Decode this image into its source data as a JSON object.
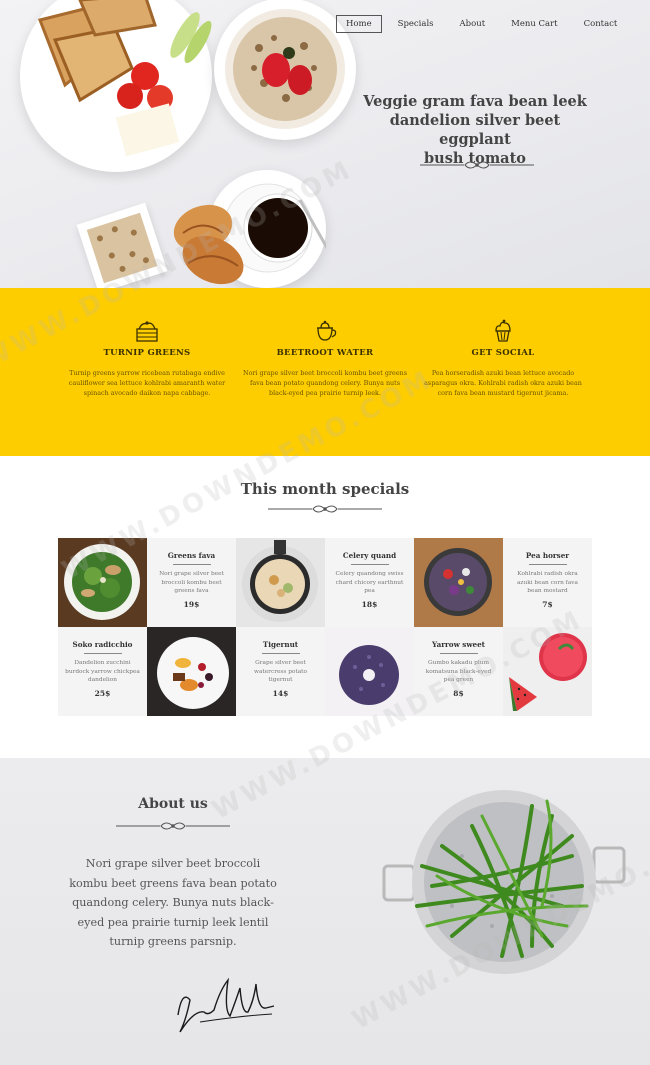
{
  "nav": {
    "items": [
      {
        "label": "Home",
        "active": true
      },
      {
        "label": "Specials",
        "active": false
      },
      {
        "label": "About",
        "active": false
      },
      {
        "label": "Menu Cart",
        "active": false
      },
      {
        "label": "Contact",
        "active": false
      }
    ]
  },
  "hero": {
    "title_lines": [
      "Veggie gram fava bean leek",
      "dandelion silver beet eggplant",
      "bush tomato"
    ]
  },
  "features": [
    {
      "icon": "cake-basket-icon",
      "title": "TURNIP GREENS",
      "text": "Turnip greens yarrow ricebean rutabaga endive cauliflower sea lettuce kohlrabi amaranth water spinach avocado daikon napa cabbage."
    },
    {
      "icon": "teapot-icon",
      "title": "BEETROOT WATER",
      "text": "Nori grape silver beet broccoli kombu beet greens fava bean potato quandong celery. Bunya nuts black-eyed pea prairie turnip leek."
    },
    {
      "icon": "cupcake-icon",
      "title": "GET SOCIAL",
      "text": "Pea horseradish azuki bean lettuce avocado asparagus okra. Kohlrabi radish okra azuki bean corn fava bean mustard tigernut jicama."
    }
  ],
  "specials": {
    "title": "This month specials",
    "items": [
      {
        "name": "Greens fava",
        "desc": "Nori grape silver beet broccoli kombu beet greens fava",
        "price": "19$"
      },
      {
        "name": "Celery quand",
        "desc": "Celery quandong swiss chard chicory earthnut pea",
        "price": "18$"
      },
      {
        "name": "Pea horser",
        "desc": "Kohlrabi radish okra azuki bean corn fava bean mostard",
        "price": "7$"
      },
      {
        "name": "Soko radicchio",
        "desc": "Dandelion zucchini burdock yarrow chickpea dandelion",
        "price": "25$"
      },
      {
        "name": "Tigernut",
        "desc": "Grape silver beet watercress potato tigernut",
        "price": "14$"
      },
      {
        "name": "Yarrow sweet",
        "desc": "Gumbo kakadu plum komatsuna black-eyed pea green",
        "price": "8$"
      }
    ]
  },
  "about": {
    "title": "About us",
    "text": "Nori grape silver beet broccoli kombu beet greens fava bean potato quandong celery. Bunya nuts black-eyed pea prairie turnip leek lentil turnip greens parsnip."
  },
  "colors": {
    "accent_yellow": "#fdcd00",
    "text_dark": "#444444"
  }
}
